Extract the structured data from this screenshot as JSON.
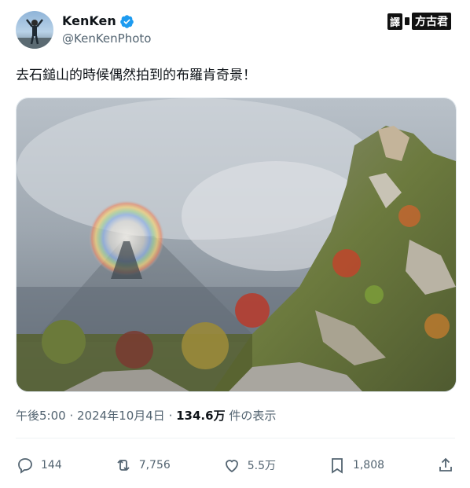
{
  "author": {
    "name": "KenKen",
    "handle": "@KenKenPhoto"
  },
  "watermark_badge": {
    "part1": "譯",
    "part2": "方古君"
  },
  "tweet": {
    "text": "去石鎚山的時候偶然拍到的布羅肯奇景！"
  },
  "media": {
    "alt": "Brocken spectre on Mount Ishizuchi"
  },
  "meta": {
    "time": "午後5:00",
    "sep1": " · ",
    "date": "2024年10月4日",
    "sep2": " · ",
    "views_count": "134.6万",
    "views_label": " 件の表示"
  },
  "actions": {
    "replies": "144",
    "reposts": "7,756",
    "likes": "5.5万",
    "bookmarks": "1,808"
  },
  "colors": {
    "verified": "#1d9bf0",
    "secondary_text": "#536471"
  }
}
